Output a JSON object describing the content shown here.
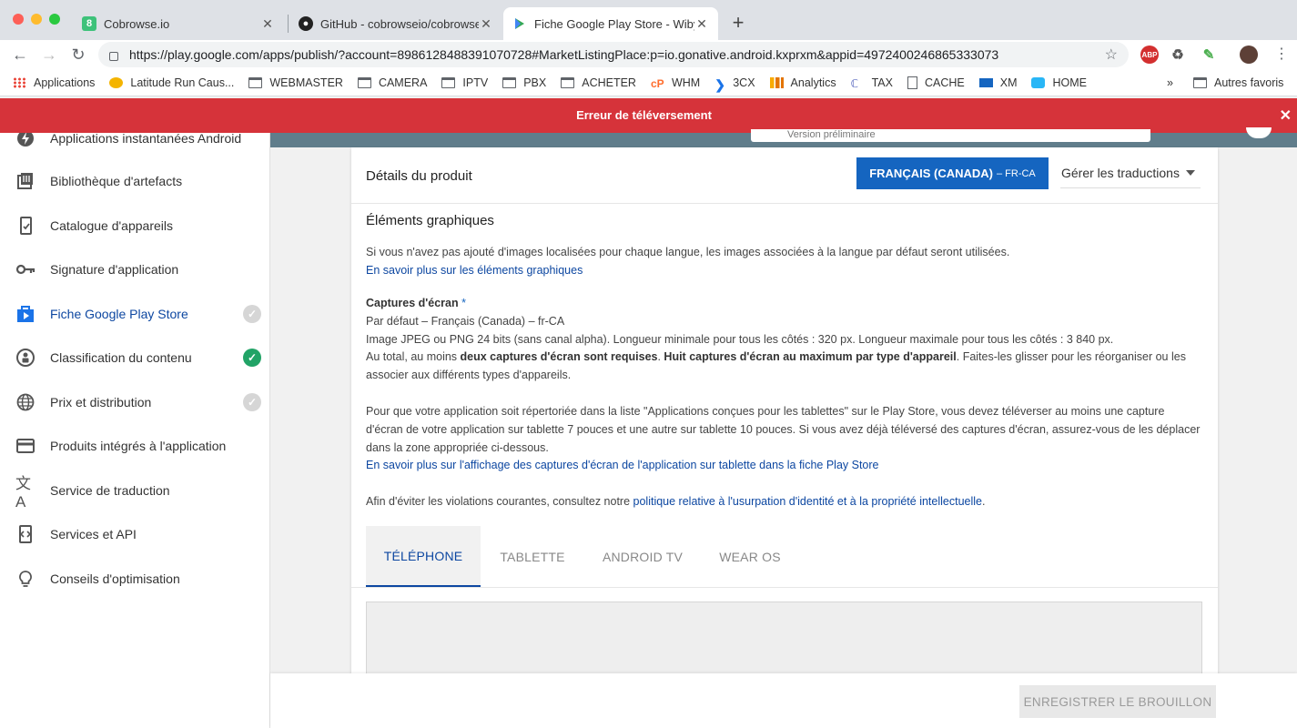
{
  "browser": {
    "tabs": [
      {
        "title": "Cobrowse.io",
        "icon": "cobrowse-icon"
      },
      {
        "title": "GitHub - cobrowseio/cobrowse",
        "icon": "github-icon"
      },
      {
        "title": "Fiche Google Play Store - Wiby",
        "icon": "play-store-icon"
      }
    ],
    "url": "https://play.google.com/apps/publish/?account=8986128488391070728#MarketListingPlace:p=io.gonative.android.kxprxm&appid=4972400246865333073",
    "bookmarks": [
      {
        "label": "Applications",
        "icon": "apps-grid-icon"
      },
      {
        "label": "Latitude Run Caus...",
        "icon": "latitude-icon"
      },
      {
        "label": "WEBMASTER",
        "icon": "folder-icon"
      },
      {
        "label": "CAMERA",
        "icon": "folder-icon"
      },
      {
        "label": "IPTV",
        "icon": "folder-icon"
      },
      {
        "label": "PBX",
        "icon": "folder-icon"
      },
      {
        "label": "ACHETER",
        "icon": "folder-icon"
      },
      {
        "label": "WHM",
        "icon": "cpanel-icon"
      },
      {
        "label": "3CX",
        "icon": "3cx-icon"
      },
      {
        "label": "Analytics",
        "icon": "analytics-icon"
      },
      {
        "label": "TAX",
        "icon": "tax-icon"
      },
      {
        "label": "CACHE",
        "icon": "page-icon"
      },
      {
        "label": "XM",
        "icon": "xm-icon"
      },
      {
        "label": "HOME",
        "icon": "home-icon"
      }
    ],
    "bookmarks_more": "»",
    "other_bookmarks": "Autres favoris"
  },
  "banner": {
    "message": "Erreur de téléversement",
    "close": "✕"
  },
  "sidebar": {
    "items": [
      {
        "label": "Applications instantanées Android",
        "icon": "instant-app-icon",
        "status": ""
      },
      {
        "label": "Bibliothèque d'artefacts",
        "icon": "library-icon",
        "status": ""
      },
      {
        "label": "Catalogue d'appareils",
        "icon": "device-catalog-icon",
        "status": ""
      },
      {
        "label": "Signature d'application",
        "icon": "key-icon",
        "status": ""
      },
      {
        "label": "Fiche Google Play Store",
        "icon": "play-store-icon",
        "status": "grey"
      },
      {
        "label": "Classification du contenu",
        "icon": "content-rating-icon",
        "status": "green"
      },
      {
        "label": "Prix et distribution",
        "icon": "globe-icon",
        "status": "grey"
      },
      {
        "label": "Produits intégrés à l'application",
        "icon": "card-icon",
        "status": ""
      },
      {
        "label": "Service de traduction",
        "icon": "translate-icon",
        "status": ""
      },
      {
        "label": "Services et API",
        "icon": "api-icon",
        "status": ""
      },
      {
        "label": "Conseils d'optimisation",
        "icon": "lightbulb-icon",
        "status": ""
      }
    ]
  },
  "topbar": {
    "track_select": "Version préliminaire"
  },
  "card": {
    "title": "Détails du produit",
    "language_button": "FRANÇAIS (CANADA)",
    "language_code": "– FR-CA",
    "manage_translations": "Gérer les traductions",
    "section_title": "Éléments graphiques",
    "intro": "Si vous n'avez pas ajouté d'images localisées pour chaque langue, les images associées à la langue par défaut seront utilisées.",
    "intro_link": "En savoir plus sur les éléments graphiques",
    "screenshots_label": "Captures d'écran",
    "required_mark": "*",
    "default_lang": "Par défaut – Français (Canada) – fr-CA",
    "format_info": "Image JPEG ou PNG 24 bits (sans canal alpha). Longueur minimale pour tous les côtés : 320 px. Longueur maximale pour tous les côtés : 3 840 px.",
    "total_prefix": "Au total, au moins ",
    "total_bold1": "deux captures d'écran sont requises",
    "total_mid": ". ",
    "total_bold2": "Huit captures d'écran au maximum par type d'appareil",
    "total_suffix": ". Faites-les glisser pour les réorganiser ou les associer aux différents types d'appareils.",
    "tablet_info": "Pour que votre application soit répertoriée dans la liste \"Applications conçues pour les tablettes\" sur le Play Store, vous devez téléverser au moins une capture d'écran de votre application sur tablette 7 pouces et une autre sur tablette 10 pouces. Si vous avez déjà téléversé des captures d'écran, assurez-vous de les déplacer dans la zone appropriée ci-dessous.",
    "tablet_link": "En savoir plus sur l'affichage des captures d'écran de l'application sur tablette dans la fiche Play Store",
    "policy_prefix": "Afin d'éviter les violations courantes, consultez notre ",
    "policy_link": "politique relative à l'usurpation d'identité et à la propriété intellectuelle",
    "policy_suffix": ".",
    "device_tabs": [
      "TÉLÉPHONE",
      "TABLETTE",
      "ANDROID TV",
      "WEAR OS"
    ]
  },
  "footer": {
    "save_draft": "ENREGISTRER LE BROUILLON"
  }
}
